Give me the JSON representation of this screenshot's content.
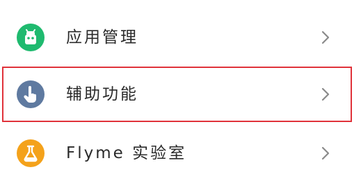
{
  "settings": {
    "items": [
      {
        "label": "应用管理",
        "icon": "app-management-icon",
        "icon_color": "#1fba6f"
      },
      {
        "label": "辅助功能",
        "icon": "accessibility-icon",
        "icon_color": "#5f7aa0"
      },
      {
        "label": "Flyme 实验室",
        "icon": "lab-flask-icon",
        "icon_color": "#f4a21b"
      }
    ]
  },
  "highlight": {
    "color": "#e0323a",
    "target": "辅助功能"
  }
}
